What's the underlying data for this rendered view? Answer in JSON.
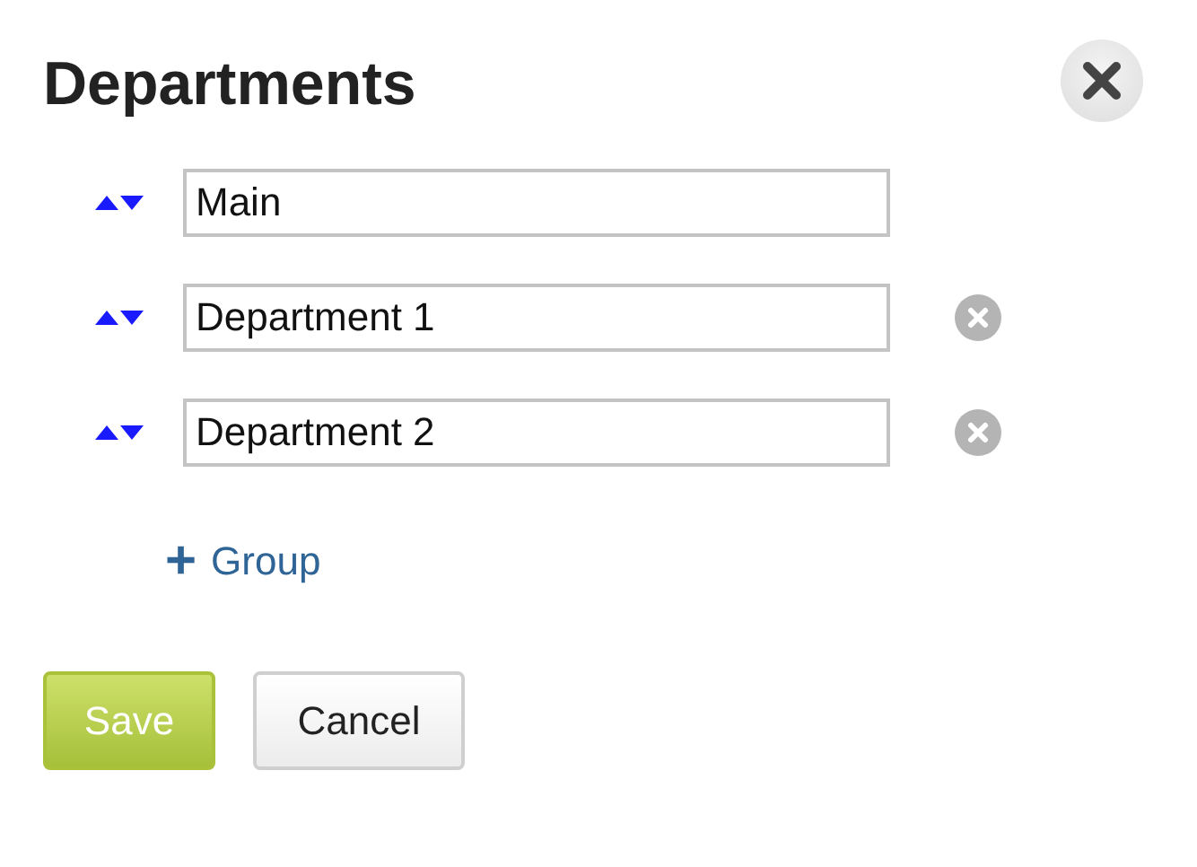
{
  "dialog": {
    "title": "Departments"
  },
  "departments": [
    {
      "value": "Main",
      "removable": false
    },
    {
      "value": "Department 1",
      "removable": true
    },
    {
      "value": "Department 2",
      "removable": true
    }
  ],
  "add_link": {
    "icon": "+",
    "label": "Group"
  },
  "buttons": [
    {
      "label": "Save",
      "kind": "primary"
    },
    {
      "label": "Cancel",
      "kind": "secondary"
    }
  ]
}
